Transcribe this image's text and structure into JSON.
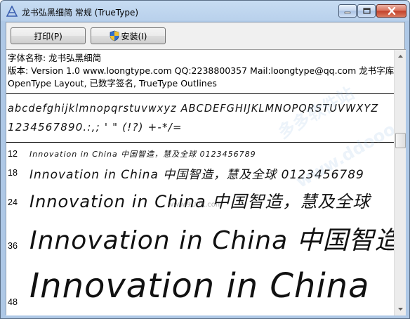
{
  "window": {
    "title": "龙书弘黑细简 常规 (TrueType)"
  },
  "toolbar": {
    "print_label": "打印(P)",
    "install_label": "安装(I)"
  },
  "info": {
    "font_name_line": "字体名称: 龙书弘黑细简",
    "version_line": "版本: Version 1.0  www.loongtype.com QQ:2238800357 Mail:loongtype@qq.com 龙书字库",
    "features_line": "OpenType Layout, 已数字签名, TrueType Outlines"
  },
  "charset": {
    "line1": "abcdefghijklmnopqrstuvwxyz  ABCDEFGHIJKLMNOPQRSTUVWXYZ",
    "line2": "1234567890.:,; ' \" (!?) +-*/="
  },
  "samples": [
    {
      "size": "12",
      "text": "Innovation in China 中国智造，慧及全球 0123456789"
    },
    {
      "size": "18",
      "text": "Innovation in China 中国智造，慧及全球 0123456789"
    },
    {
      "size": "24",
      "text": "Innovation in China 中国智造，慧及全球"
    },
    {
      "size": "36",
      "text": "Innovation in China 中国智造"
    },
    {
      "size": "48",
      "text": "Innovation in China"
    }
  ],
  "watermarks": {
    "w1": "www.9UPK.com",
    "w2": "多多软件站",
    "w3": "www.ddooo.com"
  },
  "colors": {
    "titlebar": "#b9d1ec",
    "close_button": "#c2402a",
    "shield_blue": "#2f6fcf",
    "shield_yellow": "#f2c12e"
  }
}
